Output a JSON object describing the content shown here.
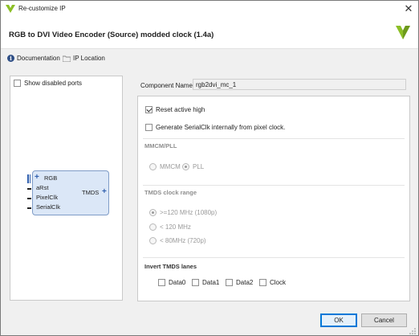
{
  "window": {
    "title": "Re-customize IP",
    "close_glyph": "✕"
  },
  "header": {
    "title": "RGB to DVI Video Encoder (Source) modded clock (1.4a)",
    "logo_icon": "vivado-logo-icon"
  },
  "toolbar": {
    "documentation": "Documentation",
    "ip_location": "IP Location"
  },
  "left_panel": {
    "show_disabled_ports": "Show disabled ports",
    "show_disabled_ports_checked": false,
    "block": {
      "input_ports": [
        "RGB",
        "aRst",
        "PixelClk",
        "SerialClk"
      ],
      "output_port": "TMDS"
    }
  },
  "component": {
    "label": "Component Name",
    "value": "rgb2dvi_mc_1"
  },
  "options": {
    "reset_active_high": {
      "label": "Reset active high",
      "checked": true
    },
    "generate_serialclk": {
      "label": "Generate SerialClk internally from pixel clock.",
      "checked": false
    },
    "mmcm_pll": {
      "title": "MMCM/PLL",
      "choices": [
        "MMCM",
        "PLL"
      ],
      "selected": "PLL"
    },
    "tmds_clock_range": {
      "title": "TMDS clock range",
      "choices": [
        ">=120 MHz (1080p)",
        "< 120 MHz",
        "< 80MHz (720p)"
      ],
      "selected": ">=120 MHz (1080p)"
    },
    "invert_tmds_lanes": {
      "title": "Invert TMDS lanes",
      "lanes": [
        "Data0",
        "Data1",
        "Data2",
        "Clock"
      ]
    }
  },
  "buttons": {
    "ok": "OK",
    "cancel": "Cancel"
  },
  "colors": {
    "accent": "#0078d7",
    "block_fill": "#dbe7f7",
    "logo_green": "#8cbf26"
  }
}
